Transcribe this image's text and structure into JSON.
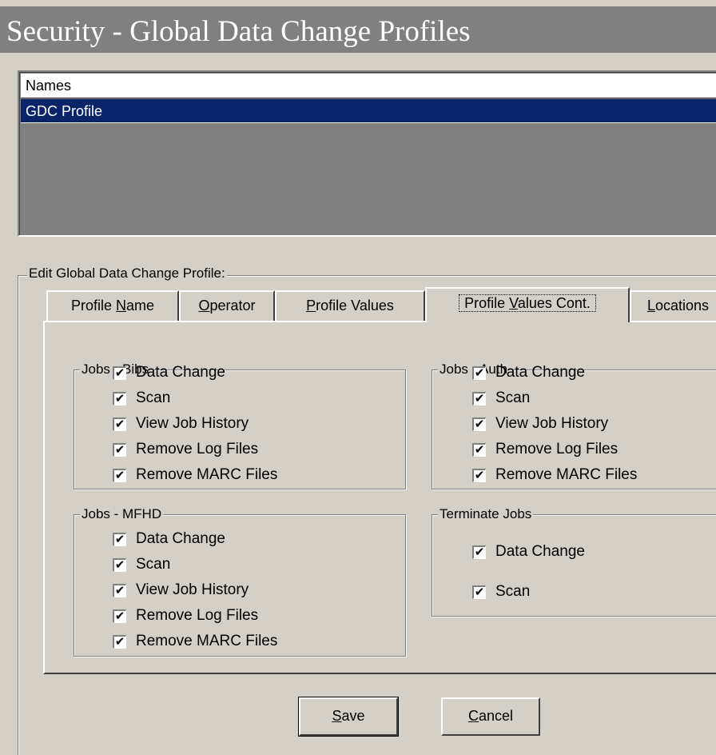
{
  "window": {
    "title": "Security - Global Data Change Profiles"
  },
  "names_list": {
    "header": "Names",
    "items": [
      "GDC Profile"
    ]
  },
  "edit_group": {
    "label": "Edit  Global Data Change Profile:"
  },
  "tabs": [
    {
      "pre": "Profile ",
      "mnemonic": "N",
      "post": "ame"
    },
    {
      "pre": "",
      "mnemonic": "O",
      "post": "perator"
    },
    {
      "pre": "",
      "mnemonic": "P",
      "post": "rofile Values"
    },
    {
      "pre": "Profile ",
      "mnemonic": "V",
      "post": "alues Cont."
    },
    {
      "pre": "",
      "mnemonic": "L",
      "post": "ocations"
    }
  ],
  "groups": {
    "jobs_bibs": {
      "label": "Jobs - Bibs",
      "items": [
        "Data Change",
        "Scan",
        "View Job History",
        "Remove Log Files",
        "Remove MARC Files"
      ]
    },
    "jobs_auth": {
      "label": "Jobs - Auth",
      "items": [
        "Data Change",
        "Scan",
        "View Job History",
        "Remove Log Files",
        "Remove MARC Files"
      ]
    },
    "jobs_mfhd": {
      "label": "Jobs - MFHD",
      "items": [
        "Data Change",
        "Scan",
        "View Job History",
        "Remove Log Files",
        "Remove MARC Files"
      ]
    },
    "terminate_jobs": {
      "label": "Terminate Jobs",
      "items": [
        "Data Change",
        "Scan"
      ]
    }
  },
  "checkbox_glyph": "✔",
  "buttons": {
    "save": {
      "mnemonic": "S",
      "post": "ave"
    },
    "cancel": {
      "mnemonic": "C",
      "post": "ancel"
    }
  }
}
